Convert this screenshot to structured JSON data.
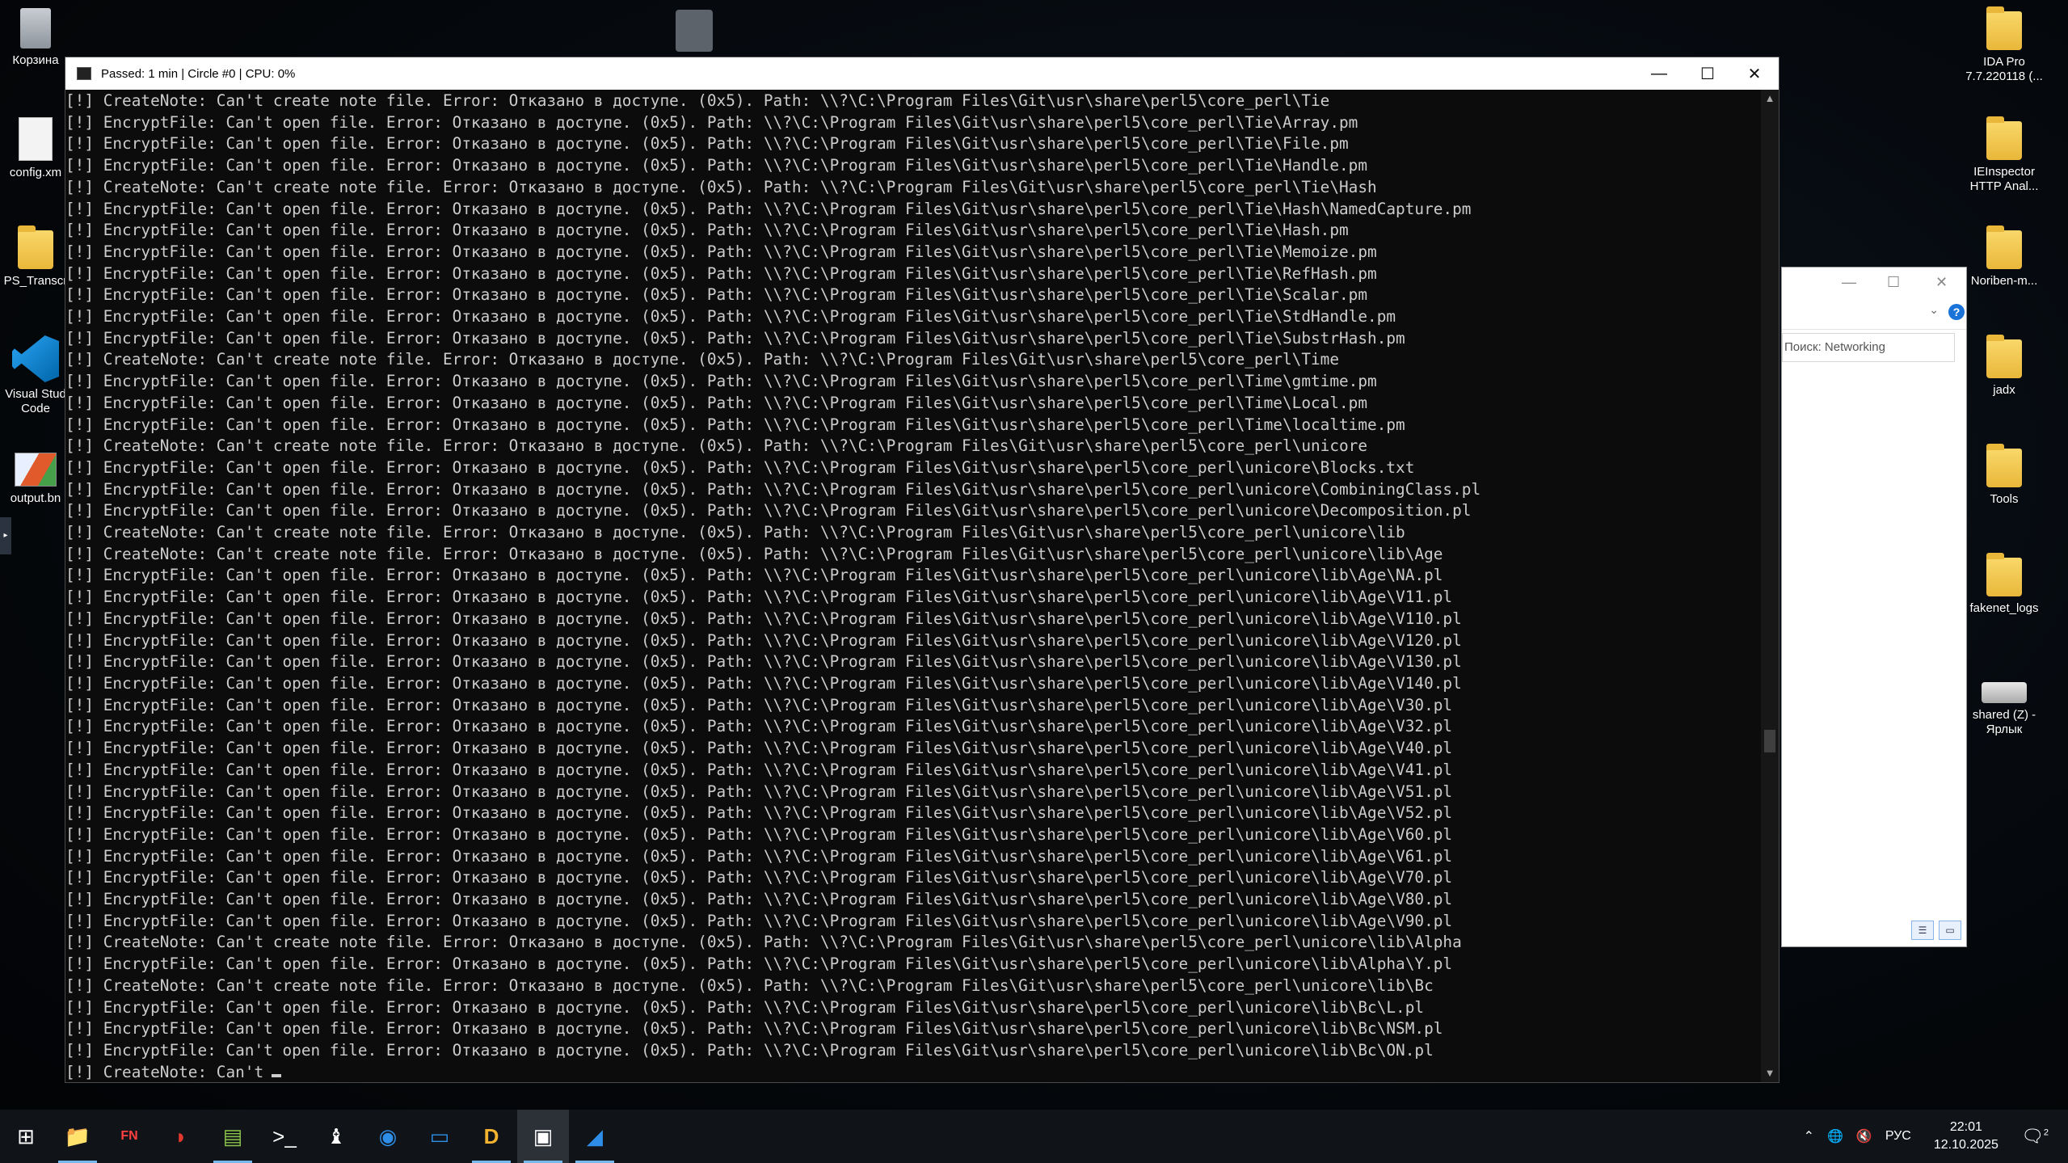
{
  "desktop": {
    "icons_left": [
      {
        "label": "Корзина",
        "icon": "recycle-bin-icon"
      },
      {
        "label": "config.xm",
        "icon": "xml-file-icon"
      },
      {
        "label": "PS_Transcr",
        "icon": "folder-icon"
      },
      {
        "label": "Visual Stud Code",
        "icon": "vscode-icon"
      },
      {
        "label": "output.bn",
        "icon": "bitmap-file-icon"
      }
    ],
    "icons_right": [
      {
        "label": "IDA Pro 7.7.220118 (...",
        "icon": "folder-icon"
      },
      {
        "label": "IEInspector HTTP Anal...",
        "icon": "folder-icon"
      },
      {
        "label": "Noriben-m...",
        "icon": "folder-icon"
      },
      {
        "label": "jadx",
        "icon": "folder-icon"
      },
      {
        "label": "Tools",
        "icon": "folder-icon"
      },
      {
        "label": "fakenet_logs",
        "icon": "folder-icon"
      },
      {
        "label": "shared (Z) - Ярлык",
        "icon": "network-drive-icon"
      }
    ]
  },
  "console": {
    "title": "Passed: 1 min | Circle #0 | CPU: 0%",
    "lines": [
      "[!] CreateNote: Can't create note file. Error: Отказано в доступе. (0x5). Path: \\\\?\\C:\\Program Files\\Git\\usr\\share\\perl5\\core_perl\\Tie",
      "[!] EncryptFile: Can't open file. Error: Отказано в доступе. (0x5). Path: \\\\?\\C:\\Program Files\\Git\\usr\\share\\perl5\\core_perl\\Tie\\Array.pm",
      "[!] EncryptFile: Can't open file. Error: Отказано в доступе. (0x5). Path: \\\\?\\C:\\Program Files\\Git\\usr\\share\\perl5\\core_perl\\Tie\\File.pm",
      "[!] EncryptFile: Can't open file. Error: Отказано в доступе. (0x5). Path: \\\\?\\C:\\Program Files\\Git\\usr\\share\\perl5\\core_perl\\Tie\\Handle.pm",
      "[!] CreateNote: Can't create note file. Error: Отказано в доступе. (0x5). Path: \\\\?\\C:\\Program Files\\Git\\usr\\share\\perl5\\core_perl\\Tie\\Hash",
      "[!] EncryptFile: Can't open file. Error: Отказано в доступе. (0x5). Path: \\\\?\\C:\\Program Files\\Git\\usr\\share\\perl5\\core_perl\\Tie\\Hash\\NamedCapture.pm",
      "[!] EncryptFile: Can't open file. Error: Отказано в доступе. (0x5). Path: \\\\?\\C:\\Program Files\\Git\\usr\\share\\perl5\\core_perl\\Tie\\Hash.pm",
      "[!] EncryptFile: Can't open file. Error: Отказано в доступе. (0x5). Path: \\\\?\\C:\\Program Files\\Git\\usr\\share\\perl5\\core_perl\\Tie\\Memoize.pm",
      "[!] EncryptFile: Can't open file. Error: Отказано в доступе. (0x5). Path: \\\\?\\C:\\Program Files\\Git\\usr\\share\\perl5\\core_perl\\Tie\\RefHash.pm",
      "[!] EncryptFile: Can't open file. Error: Отказано в доступе. (0x5). Path: \\\\?\\C:\\Program Files\\Git\\usr\\share\\perl5\\core_perl\\Tie\\Scalar.pm",
      "[!] EncryptFile: Can't open file. Error: Отказано в доступе. (0x5). Path: \\\\?\\C:\\Program Files\\Git\\usr\\share\\perl5\\core_perl\\Tie\\StdHandle.pm",
      "[!] EncryptFile: Can't open file. Error: Отказано в доступе. (0x5). Path: \\\\?\\C:\\Program Files\\Git\\usr\\share\\perl5\\core_perl\\Tie\\SubstrHash.pm",
      "[!] CreateNote: Can't create note file. Error: Отказано в доступе. (0x5). Path: \\\\?\\C:\\Program Files\\Git\\usr\\share\\perl5\\core_perl\\Time",
      "[!] EncryptFile: Can't open file. Error: Отказано в доступе. (0x5). Path: \\\\?\\C:\\Program Files\\Git\\usr\\share\\perl5\\core_perl\\Time\\gmtime.pm",
      "[!] EncryptFile: Can't open file. Error: Отказано в доступе. (0x5). Path: \\\\?\\C:\\Program Files\\Git\\usr\\share\\perl5\\core_perl\\Time\\Local.pm",
      "[!] EncryptFile: Can't open file. Error: Отказано в доступе. (0x5). Path: \\\\?\\C:\\Program Files\\Git\\usr\\share\\perl5\\core_perl\\Time\\localtime.pm",
      "[!] CreateNote: Can't create note file. Error: Отказано в доступе. (0x5). Path: \\\\?\\C:\\Program Files\\Git\\usr\\share\\perl5\\core_perl\\unicore",
      "[!] EncryptFile: Can't open file. Error: Отказано в доступе. (0x5). Path: \\\\?\\C:\\Program Files\\Git\\usr\\share\\perl5\\core_perl\\unicore\\Blocks.txt",
      "[!] EncryptFile: Can't open file. Error: Отказано в доступе. (0x5). Path: \\\\?\\C:\\Program Files\\Git\\usr\\share\\perl5\\core_perl\\unicore\\CombiningClass.pl",
      "[!] EncryptFile: Can't open file. Error: Отказано в доступе. (0x5). Path: \\\\?\\C:\\Program Files\\Git\\usr\\share\\perl5\\core_perl\\unicore\\Decomposition.pl",
      "[!] CreateNote: Can't create note file. Error: Отказано в доступе. (0x5). Path: \\\\?\\C:\\Program Files\\Git\\usr\\share\\perl5\\core_perl\\unicore\\lib",
      "[!] CreateNote: Can't create note file. Error: Отказано в доступе. (0x5). Path: \\\\?\\C:\\Program Files\\Git\\usr\\share\\perl5\\core_perl\\unicore\\lib\\Age",
      "[!] EncryptFile: Can't open file. Error: Отказано в доступе. (0x5). Path: \\\\?\\C:\\Program Files\\Git\\usr\\share\\perl5\\core_perl\\unicore\\lib\\Age\\NA.pl",
      "[!] EncryptFile: Can't open file. Error: Отказано в доступе. (0x5). Path: \\\\?\\C:\\Program Files\\Git\\usr\\share\\perl5\\core_perl\\unicore\\lib\\Age\\V11.pl",
      "[!] EncryptFile: Can't open file. Error: Отказано в доступе. (0x5). Path: \\\\?\\C:\\Program Files\\Git\\usr\\share\\perl5\\core_perl\\unicore\\lib\\Age\\V110.pl",
      "[!] EncryptFile: Can't open file. Error: Отказано в доступе. (0x5). Path: \\\\?\\C:\\Program Files\\Git\\usr\\share\\perl5\\core_perl\\unicore\\lib\\Age\\V120.pl",
      "[!] EncryptFile: Can't open file. Error: Отказано в доступе. (0x5). Path: \\\\?\\C:\\Program Files\\Git\\usr\\share\\perl5\\core_perl\\unicore\\lib\\Age\\V130.pl",
      "[!] EncryptFile: Can't open file. Error: Отказано в доступе. (0x5). Path: \\\\?\\C:\\Program Files\\Git\\usr\\share\\perl5\\core_perl\\unicore\\lib\\Age\\V140.pl",
      "[!] EncryptFile: Can't open file. Error: Отказано в доступе. (0x5). Path: \\\\?\\C:\\Program Files\\Git\\usr\\share\\perl5\\core_perl\\unicore\\lib\\Age\\V30.pl",
      "[!] EncryptFile: Can't open file. Error: Отказано в доступе. (0x5). Path: \\\\?\\C:\\Program Files\\Git\\usr\\share\\perl5\\core_perl\\unicore\\lib\\Age\\V32.pl",
      "[!] EncryptFile: Can't open file. Error: Отказано в доступе. (0x5). Path: \\\\?\\C:\\Program Files\\Git\\usr\\share\\perl5\\core_perl\\unicore\\lib\\Age\\V40.pl",
      "[!] EncryptFile: Can't open file. Error: Отказано в доступе. (0x5). Path: \\\\?\\C:\\Program Files\\Git\\usr\\share\\perl5\\core_perl\\unicore\\lib\\Age\\V41.pl",
      "[!] EncryptFile: Can't open file. Error: Отказано в доступе. (0x5). Path: \\\\?\\C:\\Program Files\\Git\\usr\\share\\perl5\\core_perl\\unicore\\lib\\Age\\V51.pl",
      "[!] EncryptFile: Can't open file. Error: Отказано в доступе. (0x5). Path: \\\\?\\C:\\Program Files\\Git\\usr\\share\\perl5\\core_perl\\unicore\\lib\\Age\\V52.pl",
      "[!] EncryptFile: Can't open file. Error: Отказано в доступе. (0x5). Path: \\\\?\\C:\\Program Files\\Git\\usr\\share\\perl5\\core_perl\\unicore\\lib\\Age\\V60.pl",
      "[!] EncryptFile: Can't open file. Error: Отказано в доступе. (0x5). Path: \\\\?\\C:\\Program Files\\Git\\usr\\share\\perl5\\core_perl\\unicore\\lib\\Age\\V61.pl",
      "[!] EncryptFile: Can't open file. Error: Отказано в доступе. (0x5). Path: \\\\?\\C:\\Program Files\\Git\\usr\\share\\perl5\\core_perl\\unicore\\lib\\Age\\V70.pl",
      "[!] EncryptFile: Can't open file. Error: Отказано в доступе. (0x5). Path: \\\\?\\C:\\Program Files\\Git\\usr\\share\\perl5\\core_perl\\unicore\\lib\\Age\\V80.pl",
      "[!] EncryptFile: Can't open file. Error: Отказано в доступе. (0x5). Path: \\\\?\\C:\\Program Files\\Git\\usr\\share\\perl5\\core_perl\\unicore\\lib\\Age\\V90.pl",
      "[!] CreateNote: Can't create note file. Error: Отказано в доступе. (0x5). Path: \\\\?\\C:\\Program Files\\Git\\usr\\share\\perl5\\core_perl\\unicore\\lib\\Alpha",
      "[!] EncryptFile: Can't open file. Error: Отказано в доступе. (0x5). Path: \\\\?\\C:\\Program Files\\Git\\usr\\share\\perl5\\core_perl\\unicore\\lib\\Alpha\\Y.pl",
      "[!] CreateNote: Can't create note file. Error: Отказано в доступе. (0x5). Path: \\\\?\\C:\\Program Files\\Git\\usr\\share\\perl5\\core_perl\\unicore\\lib\\Bc",
      "[!] EncryptFile: Can't open file. Error: Отказано в доступе. (0x5). Path: \\\\?\\C:\\Program Files\\Git\\usr\\share\\perl5\\core_perl\\unicore\\lib\\Bc\\L.pl",
      "[!] EncryptFile: Can't open file. Error: Отказано в доступе. (0x5). Path: \\\\?\\C:\\Program Files\\Git\\usr\\share\\perl5\\core_perl\\unicore\\lib\\Bc\\NSM.pl",
      "[!] EncryptFile: Can't open file. Error: Отказано в доступе. (0x5). Path: \\\\?\\C:\\Program Files\\Git\\usr\\share\\perl5\\core_perl\\unicore\\lib\\Bc\\ON.pl"
    ],
    "last_line": "[!] CreateNote: Can't"
  },
  "explorer_window": {
    "search_placeholder": "Поиск: Networking"
  },
  "taskbar": {
    "items": [
      {
        "icon": "windows-start-icon",
        "glyph": "⊞"
      },
      {
        "icon": "file-explorer-icon",
        "glyph": "📁"
      },
      {
        "icon": "fakenet-icon",
        "glyph": "FN"
      },
      {
        "icon": "red-app-icon",
        "glyph": "◗"
      },
      {
        "icon": "notepad-icon",
        "glyph": "▤"
      },
      {
        "icon": "terminal-icon",
        "glyph": ">_"
      },
      {
        "icon": "chess-piece-icon",
        "glyph": "♝"
      },
      {
        "icon": "monitor-app-icon",
        "glyph": "◉"
      },
      {
        "icon": "network-app-icon",
        "glyph": "▭"
      },
      {
        "icon": "debugger-icon",
        "glyph": "D"
      },
      {
        "icon": "console-icon",
        "glyph": "▣"
      },
      {
        "icon": "wireshark-icon",
        "glyph": "◢"
      }
    ],
    "tray": {
      "language": "РУС",
      "time": "22:01",
      "date": "12.10.2025",
      "notification_count": "2"
    }
  },
  "colors": {
    "console_bg": "#0c0c0c",
    "console_text": "#cccccc",
    "taskbar_bg": "#101418",
    "accent": "#76b9ed"
  }
}
